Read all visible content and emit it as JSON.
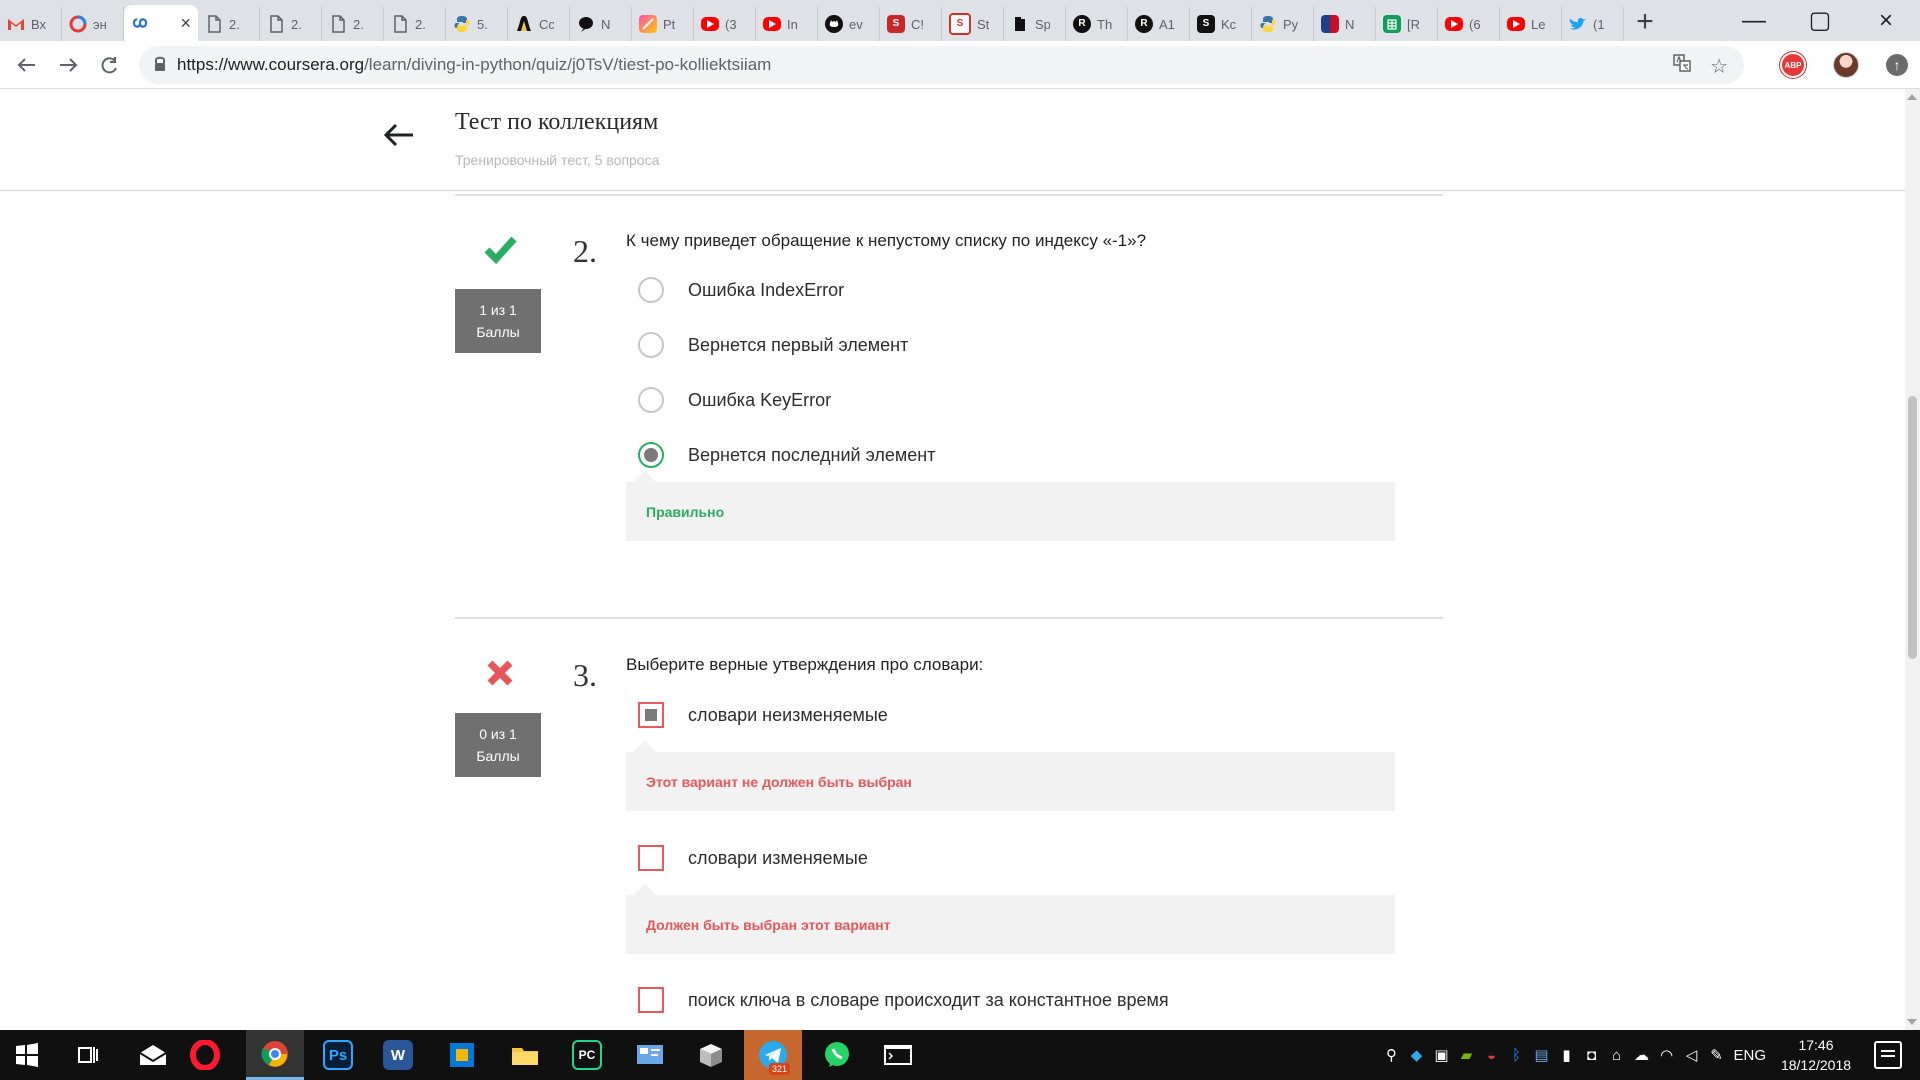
{
  "browser": {
    "tabs": [
      {
        "label": "Вх",
        "icon": "gmail-icon",
        "color": "#ea4335"
      },
      {
        "label": "эн",
        "icon": "spinner-icon",
        "color": "#e53935"
      },
      {
        "label": "",
        "icon": "coursera-icon",
        "color": "#2a73cc",
        "active": true,
        "close": "×"
      },
      {
        "label": "2.",
        "icon": "document-icon",
        "color": "#5f6368"
      },
      {
        "label": "2.",
        "icon": "document-icon",
        "color": "#5f6368"
      },
      {
        "label": "2.",
        "icon": "document-icon",
        "color": "#5f6368"
      },
      {
        "label": "2.",
        "icon": "document-icon",
        "color": "#5f6368"
      },
      {
        "label": "5.",
        "icon": "python-icon",
        "color": "#3776ab"
      },
      {
        "label": "Cc",
        "icon": "penguin-icon",
        "color": "#111111"
      },
      {
        "label": "N",
        "icon": "speech-icon",
        "color": "#111111"
      },
      {
        "label": "Pt",
        "icon": "gradient-icon",
        "color": "#ff4fb0"
      },
      {
        "label": "(3",
        "icon": "youtube-icon",
        "color": "#ff0000"
      },
      {
        "label": "In",
        "icon": "youtube-icon",
        "color": "#ff0000"
      },
      {
        "label": "ev",
        "icon": "github-icon",
        "color": "#111111"
      },
      {
        "label": "C!",
        "icon": "red-s-icon",
        "color": "#c62828"
      },
      {
        "label": "St",
        "icon": "red-box-icon",
        "color": "#d32f2f"
      },
      {
        "label": "Sp",
        "icon": "book-icon",
        "color": "#111111"
      },
      {
        "label": "Th",
        "icon": "r-circle-icon",
        "color": "#111111"
      },
      {
        "label": "A1",
        "icon": "r-circle-icon",
        "color": "#111111"
      },
      {
        "label": "Kc",
        "icon": "s-square-icon",
        "color": "#111111"
      },
      {
        "label": "Py",
        "icon": "python-icon",
        "color": "#3776ab"
      },
      {
        "label": "N",
        "icon": "nba-icon",
        "color": "#1d428a"
      },
      {
        "label": "[R",
        "icon": "sheets-icon",
        "color": "#0f9d58"
      },
      {
        "label": "(6",
        "icon": "youtube-icon",
        "color": "#ff0000"
      },
      {
        "label": "Le",
        "icon": "youtube-icon",
        "color": "#ff0000"
      },
      {
        "label": "(1",
        "icon": "twitter-icon",
        "color": "#1da1f2"
      }
    ],
    "new_tab": "+",
    "address": {
      "url_host": "https://www.coursera.org",
      "url_path": "/learn/diving-in-python/quiz/j0TsV/tiest-po-kolliektsiiam"
    },
    "extensions": {
      "abp": "ABP"
    }
  },
  "quiz": {
    "title": "Тест по коллекциям",
    "subtitle": "Тренировочный тест, 5 вопроса",
    "questions": [
      {
        "status": "correct",
        "number": "2.",
        "score_line_1": "1 из 1",
        "score_line_2": "Баллы",
        "text": "К чему приведет обращение к непустому списку по индексу «-1»?",
        "options": [
          {
            "text": "Ошибка IndexError",
            "selected": false
          },
          {
            "text": "Вернется первый элемент",
            "selected": false
          },
          {
            "text": "Ошибка KeyError",
            "selected": false
          },
          {
            "text": "Вернется последний элемент",
            "selected": true
          }
        ],
        "feedback": "Правильно"
      },
      {
        "status": "incorrect",
        "number": "3.",
        "score_line_1": "0 из 1",
        "score_line_2": "Баллы",
        "text": "Выберите верные утверждения про словари:",
        "options": [
          {
            "text": "словари неизменяемые",
            "selected": true,
            "feedback": "Этот вариант не должен быть выбран"
          },
          {
            "text": "словари изменяемые",
            "selected": false,
            "feedback": "Должен быть выбран этот вариант"
          },
          {
            "text": "поиск ключа в словаре происходит за константное время",
            "selected": false
          }
        ]
      }
    ]
  },
  "taskbar": {
    "apps": [
      {
        "name": "mail-icon",
        "color": "#111111"
      },
      {
        "name": "opera-icon",
        "color": "#ff1b2d"
      },
      {
        "name": "chrome-icon",
        "color": "#4285f4"
      },
      {
        "name": "photoshop-icon",
        "label": "Ps",
        "color": "#001e36"
      },
      {
        "name": "word-icon",
        "label": "W",
        "color": "#2b579a"
      },
      {
        "name": "tile-icon",
        "color": "#0078d7"
      },
      {
        "name": "file-explorer-icon",
        "color": "#f6c343"
      },
      {
        "name": "pycharm-icon",
        "label": "PC",
        "color": "#21d789"
      },
      {
        "name": "control-panel-icon",
        "color": "#6aa7e8"
      },
      {
        "name": "package-icon",
        "color": "#e8e8e8"
      },
      {
        "name": "telegram-icon",
        "badge": "321",
        "color": "#2aabee"
      },
      {
        "name": "whatsapp-icon",
        "color": "#25d366"
      },
      {
        "name": "terminal-icon",
        "color": "#2a2a2a"
      }
    ],
    "tray": {
      "language": "ENG",
      "time": "17:46",
      "date": "18/12/2018"
    }
  },
  "colors": {
    "correct": "#27ae60",
    "incorrect": "#e5575b",
    "score_box": "#707070",
    "feedback_bg": "#f2f2f2"
  }
}
